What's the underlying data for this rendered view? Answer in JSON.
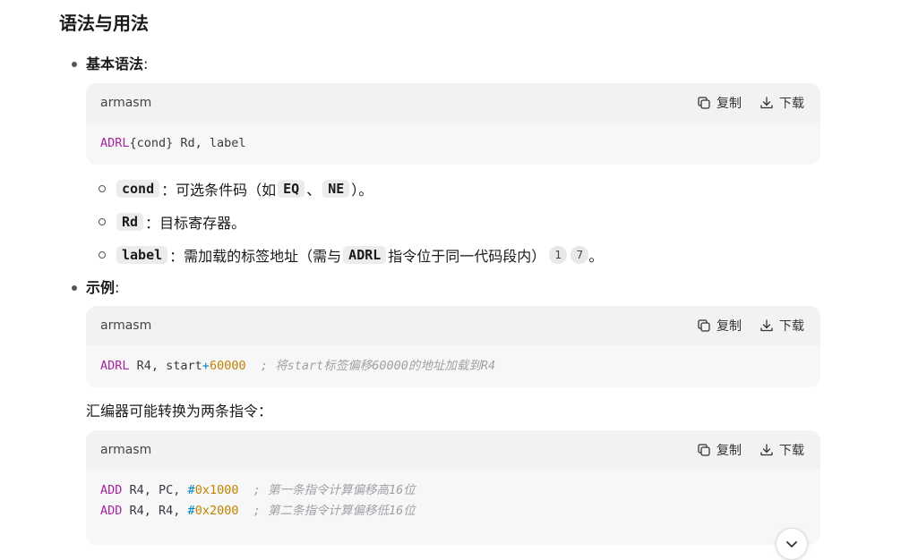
{
  "section": {
    "title": "语法与用法"
  },
  "syntax": {
    "label": "基本语法",
    "colon": ":",
    "code": {
      "lang": "armasm",
      "copy_label": "复制",
      "download_label": "下载",
      "line_kw": "ADRL",
      "line_rest": "{cond} Rd, label"
    },
    "items": [
      {
        "code": "cond",
        "text_a": "：可选条件码（如",
        "code2": "EQ",
        "sep": "、",
        "code3": "NE",
        "text_b": "）。"
      },
      {
        "code": "Rd",
        "text_a": "：目标寄存器。"
      },
      {
        "code": "label",
        "text_a": "：需加载的标签地址（需与",
        "code2": "ADRL",
        "text_b": "指令位于同一代码段内）",
        "cites": [
          "1",
          "7"
        ],
        "end": "。"
      }
    ]
  },
  "example": {
    "label": "示例",
    "colon": ":",
    "code": {
      "lang": "armasm",
      "copy_label": "复制",
      "download_label": "下载",
      "kw": "ADRL",
      "reg": " R4, start",
      "op": "+",
      "num": "60000",
      "comment": "; 将start标签偏移60000的地址加载到R4"
    },
    "followup": "汇编器可能转换为两条指令：",
    "code2": {
      "lang": "armasm",
      "copy_label": "复制",
      "download_label": "下载",
      "lines": [
        {
          "kw": "ADD",
          "regs": " R4, PC, ",
          "hash": "#",
          "num": "0x1000",
          "comment": "; 第一条指令计算偏移高16位"
        },
        {
          "kw": "ADD",
          "regs": " R4, R4, ",
          "hash": "#",
          "num": "0x2000",
          "comment": "; 第二条指令计算偏移低16位"
        }
      ]
    }
  },
  "icons": {
    "copy": "copy-icon",
    "download": "download-icon",
    "scroll": "chevron-down-icon"
  },
  "colors": {
    "keyword": "#a626a4",
    "number": "#c18401",
    "operator": "#0184bc",
    "comment": "#a0a1a7",
    "code_bg": "#f7f7f7",
    "code_header_bg": "#f2f2f2"
  }
}
